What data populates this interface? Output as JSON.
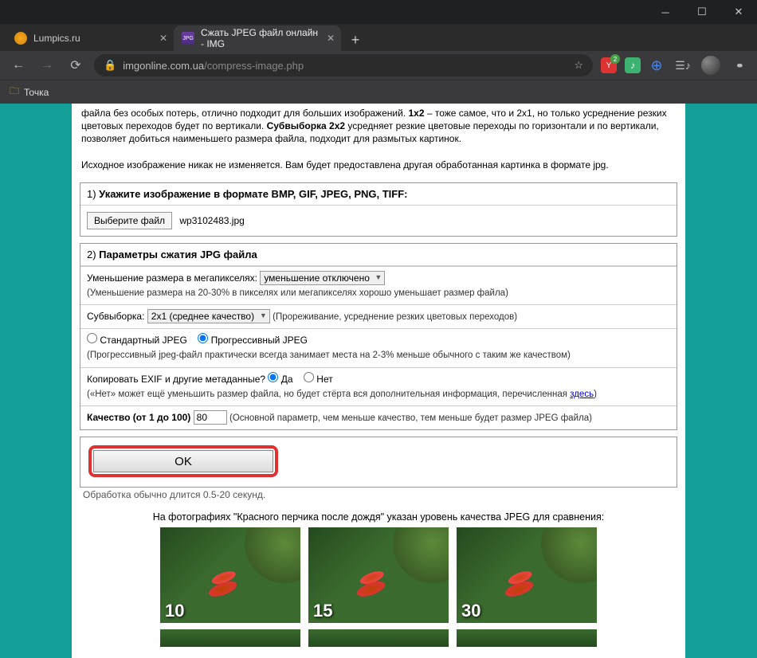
{
  "window": {
    "tabs": [
      {
        "title": "Lumpics.ru",
        "active": false
      },
      {
        "title": "Сжать JPEG файл онлайн - IMG",
        "active": true
      }
    ],
    "url_host": "imgonline.com.ua",
    "url_path": "/compress-image.php",
    "ext_badge": "2"
  },
  "bookmarks": {
    "item1": "Точка"
  },
  "intro": {
    "l1a": "файла без особых потерь, отлично подходит для больших изображений. ",
    "l1b": "1x2",
    "l1c": " – тоже самое, что и 2x1, но только усреднение резких цветовых переходов будет по вертикали. ",
    "l1d": "Субвыборка 2x2",
    "l1e": " усредняет резкие цветовые переходы по горизонтали и по вертикали, позволяет добиться наименьшего размера файла, подходит для размытых картинок.",
    "l2": "Исходное изображение никак не изменяется. Вам будет предоставлена другая обработанная картинка в формате jpg."
  },
  "panel1": {
    "num": "1) ",
    "title": "Укажите изображение в формате BMP, GIF, JPEG, PNG, TIFF:",
    "choose": "Выберите файл",
    "filename": "wp3102483.jpg"
  },
  "panel2": {
    "num": "2) ",
    "title": "Параметры сжатия JPG файла",
    "mp_label": "Уменьшение размера в мегапикселях:",
    "mp_selected": "уменьшение отключено",
    "mp_hint": "(Уменьшение размера на 20-30% в пикселях или мегапикселях хорошо уменьшает размер файла)",
    "sub_label": "Субвыборка:",
    "sub_selected": "2x1 (среднее качество)",
    "sub_hint": "(Прореживание, усреднение резких цветовых переходов)",
    "std": "Стандартный JPEG",
    "prog": "Прогрессивный JPEG",
    "prog_hint": "(Прогрессивный jpeg-файл практически всегда занимает места на 2-3% меньше обычного с таким же качеством)",
    "exif_label": "Копировать EXIF и другие метаданные?",
    "yes": "Да",
    "no": "Нет",
    "exif_hint_a": "(«Нет» может ещё уменьшить размер файла, но будет стёрта вся дополнительная информация, перечисленная ",
    "exif_hint_link": "здесь",
    "exif_hint_b": ")",
    "q_label": "Качество (от 1 до 100)",
    "q_value": "80",
    "q_hint": "(Основной параметр, чем меньше качество, тем меньше будет размер JPEG файла)"
  },
  "ok": {
    "label": "OK",
    "proc": "Обработка обычно длится 0.5-20 секунд."
  },
  "compare": {
    "title": "На фотографиях \"Красного перчика после дождя\" указан уровень качества JPEG для сравнения:",
    "q1": "10",
    "q2": "15",
    "q3": "30"
  }
}
